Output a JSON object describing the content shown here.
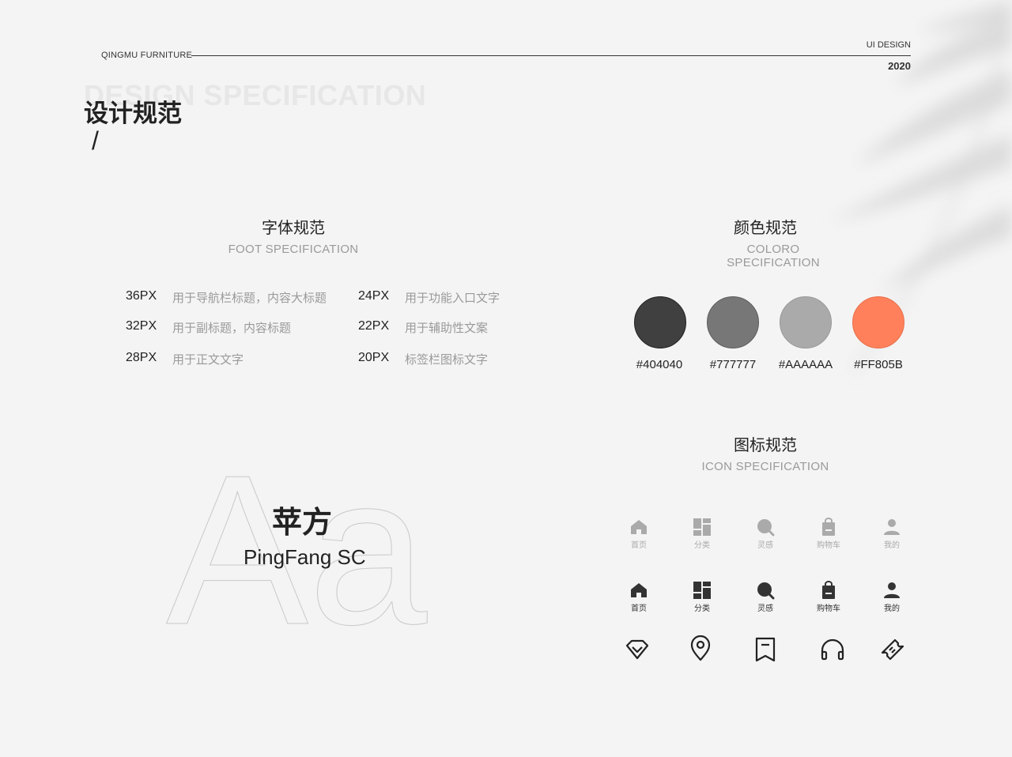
{
  "header": {
    "brand": "QINGMU FURNITURE",
    "ui_design": "UI DESIGN",
    "year": "2020",
    "bg_title": "DESIGN SPECIFICATION",
    "title": "设计规范",
    "slash": "/"
  },
  "font_section": {
    "title": "字体规范",
    "subtitle": "FOOT SPECIFICATION",
    "items": [
      {
        "size": "36PX",
        "desc": "用于导航栏标题，内容大标题"
      },
      {
        "size": "24PX",
        "desc": "用于功能入口文字"
      },
      {
        "size": "32PX",
        "desc": "用于副标题，内容标题"
      },
      {
        "size": "22PX",
        "desc": "用于辅助性文案"
      },
      {
        "size": "28PX",
        "desc": "用于正文文字"
      },
      {
        "size": "20PX",
        "desc": "标签栏图标文字"
      }
    ],
    "sample_glyphs": "Aa",
    "font_cn": "苹方",
    "font_en": "PingFang SC"
  },
  "color_section": {
    "title": "颜色规范",
    "subtitle": "COLORO SPECIFICATION",
    "colors": [
      {
        "hex": "#404040"
      },
      {
        "hex": "#777777"
      },
      {
        "hex": "#AAAAAA"
      },
      {
        "hex": "#FF805B"
      }
    ]
  },
  "icon_section": {
    "title": "图标规范",
    "subtitle": "ICON SPECIFICATION",
    "tabs": [
      {
        "label": "首页",
        "icon": "home-icon"
      },
      {
        "label": "分类",
        "icon": "category-icon"
      },
      {
        "label": "灵感",
        "icon": "inspiration-icon"
      },
      {
        "label": "购物车",
        "icon": "cart-icon"
      },
      {
        "label": "我的",
        "icon": "user-icon"
      }
    ],
    "line_icons": [
      "diamond-icon",
      "location-pin-icon",
      "bookmark-icon",
      "headphones-icon",
      "ticket-icon"
    ],
    "tab_gray": "#aaaaaa",
    "tab_dark": "#333333"
  }
}
